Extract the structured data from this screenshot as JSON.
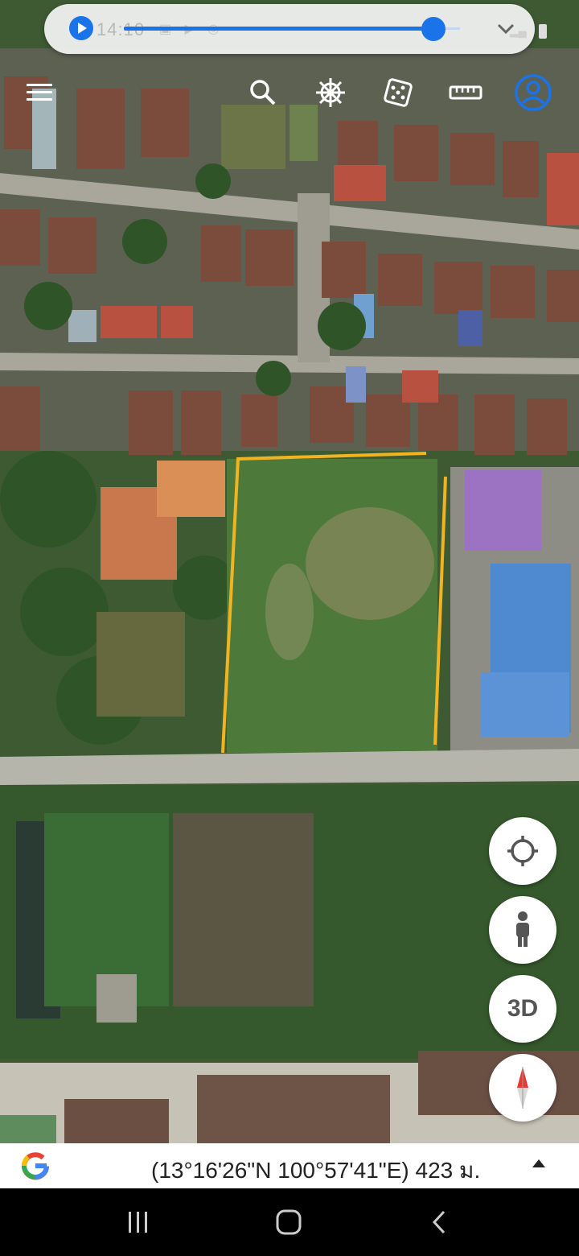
{
  "status": {
    "time": "14:10",
    "icons": [
      "image-icon",
      "youtube-icon",
      "messenger-icon",
      "dot-icon"
    ],
    "volume_level": 0.92
  },
  "toolbar": {
    "items": [
      {
        "name": "menu-icon"
      },
      {
        "name": "search-icon"
      },
      {
        "name": "voyager-wheel-icon"
      },
      {
        "name": "dice-icon"
      },
      {
        "name": "ruler-icon"
      },
      {
        "name": "account-icon"
      }
    ]
  },
  "map": {
    "view": "satellite",
    "boundary_color": "#f2b320"
  },
  "fabs": {
    "threed_label": "3D"
  },
  "info_bar": {
    "coordinates": "(13°16'26\"N 100°57'41\"E) 423 ม."
  },
  "colors": {
    "accent": "#1a73e8",
    "boundary": "#f2b320"
  }
}
